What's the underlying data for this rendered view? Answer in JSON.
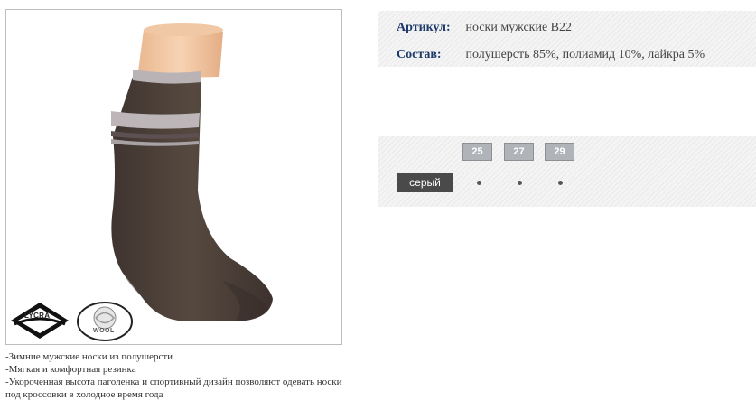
{
  "product": {
    "article_label": "Артикул:",
    "article_value": "носки мужские В22",
    "composition_label": "Состав:",
    "composition_value": "полушерсть 85%, полиамид 10%, лайкра 5%"
  },
  "badges": {
    "lycra": "LYCRA",
    "wool": "WOOL"
  },
  "sizes": [
    "25",
    "27",
    "29"
  ],
  "colors": [
    {
      "name": "серый",
      "availability": [
        "•",
        "•",
        "•"
      ]
    }
  ],
  "description": [
    "-Зимние мужские носки из полушерсти",
    "-Мягкая и комфортная резинка",
    "-Укороченная высота паголенка и спортивный дизайн позволяют одевать носки под кроссовки в холодное время года"
  ],
  "palette": {
    "sock": "#4b3f3a",
    "stripe": "#b9b3b6",
    "skin": "#f4c9a4",
    "label": "#1d3a6b",
    "color_button": "#4a4a4a",
    "size_button": "#b0b4b8"
  }
}
